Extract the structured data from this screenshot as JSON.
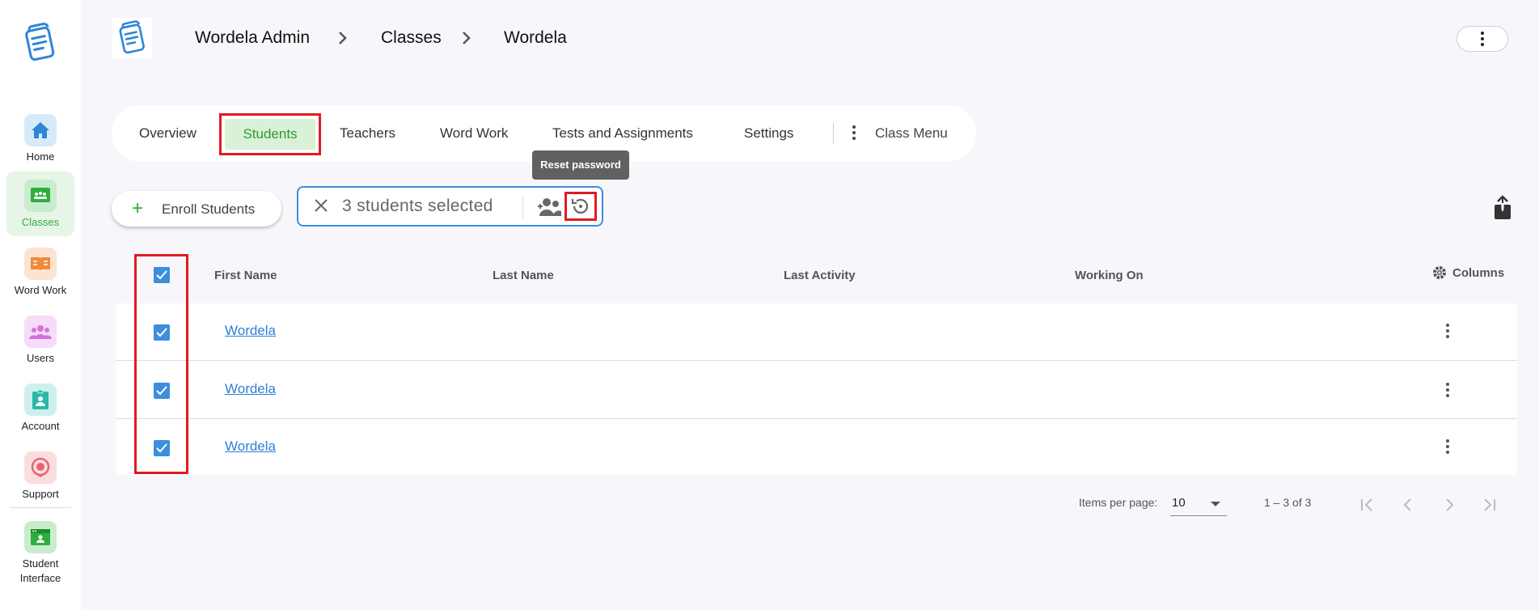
{
  "sidebar": {
    "items": [
      {
        "label": "Home",
        "icon": "home-icon",
        "color": "#2f86d6",
        "bg": "#d6ebfa"
      },
      {
        "label": "Classes",
        "icon": "classroom-icon",
        "color": "#2eae3c",
        "bg": "#c9ecce",
        "active": true
      },
      {
        "label": "Word Work",
        "icon": "book-icon",
        "color": "#f08a3c",
        "bg": "#fde3d0"
      },
      {
        "label": "Users",
        "icon": "users-icon",
        "color": "#d86fe0",
        "bg": "#f6dcf8"
      },
      {
        "label": "Account",
        "icon": "account-icon",
        "color": "#2bb8a8",
        "bg": "#cdf0eb"
      },
      {
        "label": "Support",
        "icon": "support-icon",
        "color": "#e86473",
        "bg": "#fbdde0"
      },
      {
        "label": "Student Interface",
        "icon": "student-interface-icon",
        "color": "#2eae3c",
        "bg": "#c9ecce"
      }
    ]
  },
  "header": {
    "breadcrumb": [
      "Wordela Admin",
      "Classes",
      "Wordela"
    ]
  },
  "tabs": {
    "items": [
      "Overview",
      "Students",
      "Teachers",
      "Word Work",
      "Tests and Assignments",
      "Settings"
    ],
    "active": "Students",
    "class_menu": "Class Menu"
  },
  "tooltip": "Reset password",
  "actions": {
    "enroll": "Enroll Students",
    "selected": "3 students selected"
  },
  "table": {
    "columns": [
      "First Name",
      "Last Name",
      "Last Activity",
      "Working On"
    ],
    "columns_button": "Columns",
    "rows": [
      {
        "first_name": "Wordela",
        "last_name": "",
        "last_activity": "",
        "working_on": "",
        "checked": true
      },
      {
        "first_name": "Wordela",
        "last_name": "",
        "last_activity": "",
        "working_on": "",
        "checked": true
      },
      {
        "first_name": "Wordela",
        "last_name": "",
        "last_activity": "",
        "working_on": "",
        "checked": true
      }
    ]
  },
  "pagination": {
    "items_per_page_label": "Items per page:",
    "items_per_page": "10",
    "range": "1 – 3 of 3"
  },
  "colors": {
    "accent_blue": "#3d8edc",
    "accent_green": "#2eae3c",
    "highlight_red": "#e01b22"
  }
}
